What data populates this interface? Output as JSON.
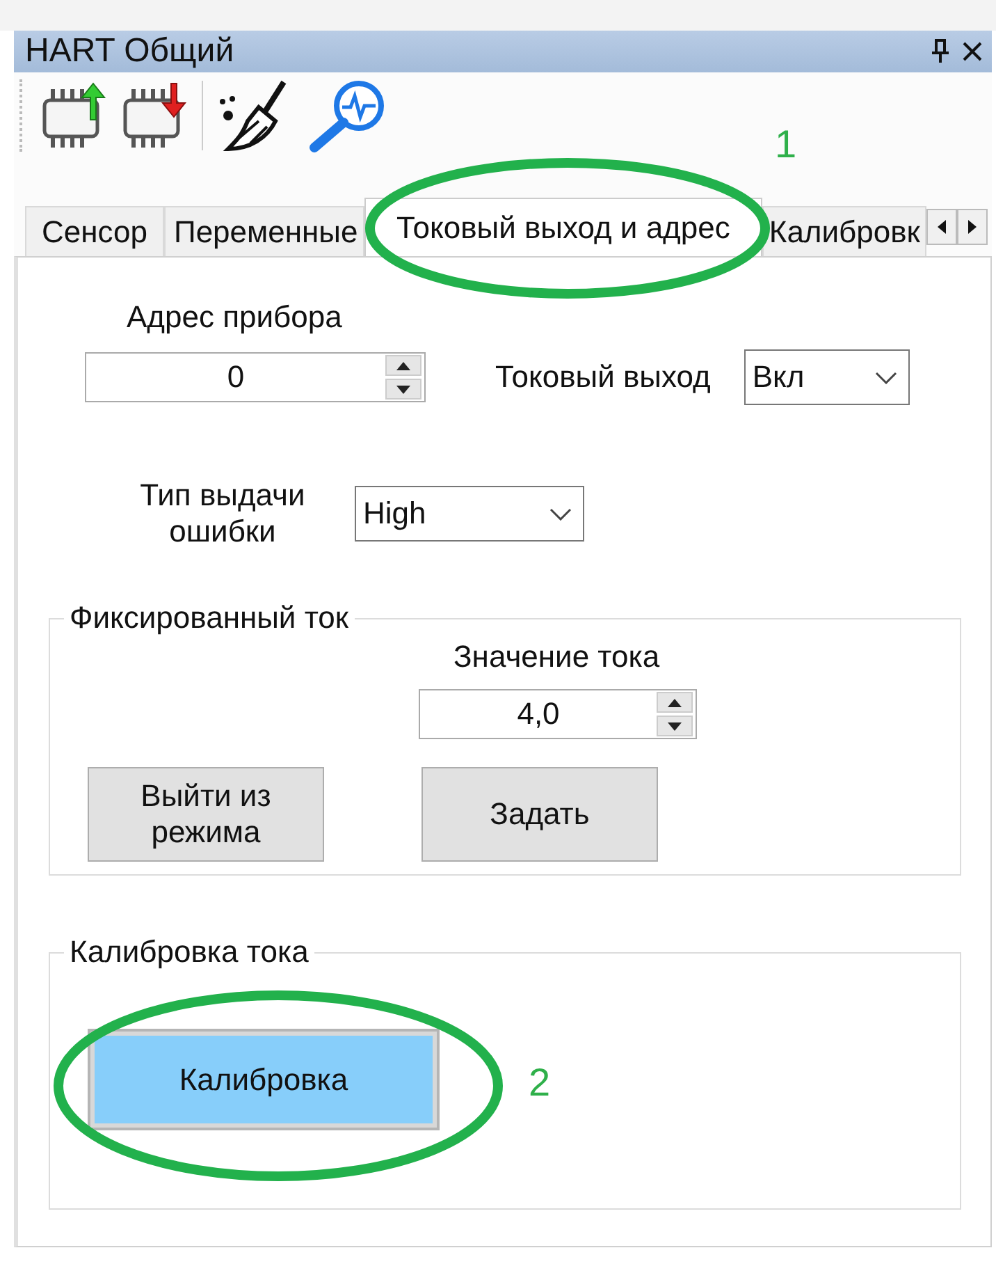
{
  "window": {
    "title": "HART Общий"
  },
  "tabs": [
    {
      "label": "Сенсор",
      "selected": false
    },
    {
      "label": "Переменные",
      "selected": false
    },
    {
      "label": "Токовый выход и адрес",
      "selected": true
    },
    {
      "label": "Калибровк",
      "selected": false
    }
  ],
  "device_address": {
    "label": "Адрес прибора",
    "value": "0"
  },
  "current_output": {
    "label": "Токовый выход",
    "value": "Вкл"
  },
  "error_type": {
    "label": "Тип выдачи ошибки",
    "value": "High"
  },
  "fixed_current": {
    "title": "Фиксированный ток",
    "value_label": "Значение тока",
    "value": "4,0",
    "buttons": [
      "Выйти из режима",
      "Задать"
    ]
  },
  "current_calibration": {
    "title": "Калибровка тока",
    "button": {
      "label": "Калибровка",
      "highlighted": true
    }
  },
  "annotations": [
    {
      "label": "1"
    },
    {
      "label": "2"
    }
  ]
}
